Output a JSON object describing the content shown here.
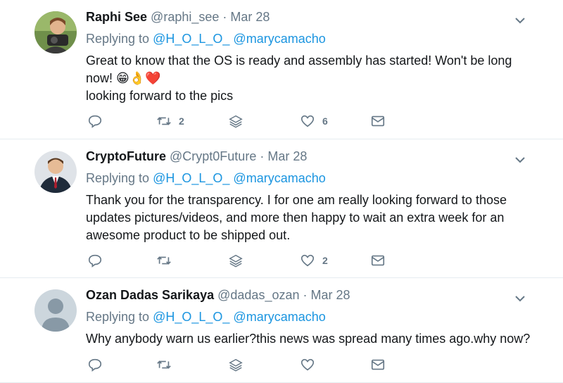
{
  "tweets": [
    {
      "name": "Raphi See",
      "handle": "@raphi_see",
      "separator": "·",
      "date": "Mar 28",
      "replying_prefix": "Replying to",
      "mentions": [
        "@H_O_L_O_",
        "@marycamacho"
      ],
      "text_line1": "Great to know that the OS is ready and assembly has started! Won't be long now!",
      "emojis": "😁👌❤️",
      "text_line2": "looking forward to the pics",
      "retweet_count": "2",
      "like_count": "6"
    },
    {
      "name": "CryptoFuture",
      "handle": "@Crypt0Future",
      "separator": "·",
      "date": "Mar 28",
      "replying_prefix": "Replying to",
      "mentions": [
        "@H_O_L_O_",
        "@marycamacho"
      ],
      "text": "Thank you for the transparency. I for one am really looking forward to those updates pictures/videos, and more then happy to wait an extra week for an awesome product to be shipped out.",
      "retweet_count": "",
      "like_count": "2"
    },
    {
      "name": "Ozan Dadas Sarikaya",
      "handle": "@dadas_ozan",
      "separator": "·",
      "date": "Mar 28",
      "replying_prefix": "Replying to",
      "mentions": [
        "@H_O_L_O_",
        "@marycamacho"
      ],
      "text": "Why anybody warn us earlier?this news was spread many times ago.why now?",
      "retweet_count": "",
      "like_count": ""
    }
  ],
  "colors": {
    "link": "#1b95e0",
    "muted": "#657786",
    "text": "#14171a",
    "divider": "#e6ecf0"
  },
  "icons": {
    "reply": "reply-icon",
    "retweet": "retweet-icon",
    "layers": "layers-icon",
    "like": "heart-icon",
    "dm": "envelope-icon",
    "menu": "chevron-down-icon"
  }
}
